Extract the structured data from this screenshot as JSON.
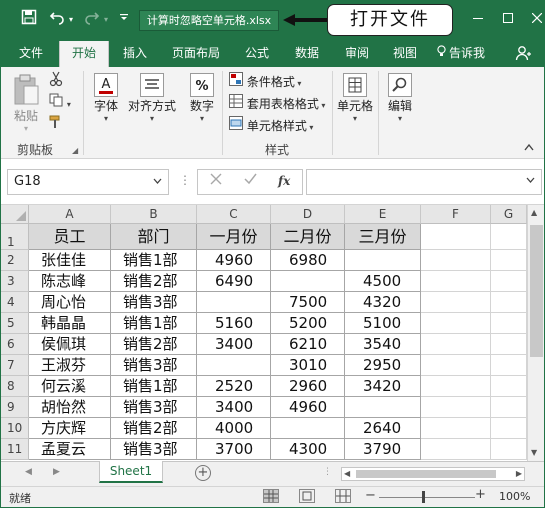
{
  "title_bar": {
    "filename": "计算时忽略空单元格.xlsx",
    "callout": "打开文件",
    "icons": [
      "save-icon",
      "undo-icon",
      "redo-icon",
      "customize-qat-icon",
      "minimize-icon",
      "restore-icon",
      "close-icon"
    ]
  },
  "ribbon_tabs": [
    "文件",
    "开始",
    "插入",
    "页面布局",
    "公式",
    "数据",
    "审阅",
    "视图"
  ],
  "active_tab": "开始",
  "tell_me": "告诉我",
  "ribbon": {
    "clipboard": {
      "paste": "粘贴",
      "group": "剪贴板"
    },
    "font": {
      "label": "字体"
    },
    "alignment": {
      "label": "对齐方式"
    },
    "number": {
      "label": "数字"
    },
    "styles": {
      "conditional": "条件格式",
      "table": "套用表格格式",
      "cell_styles": "单元格样式",
      "group": "样式"
    },
    "cells": {
      "label": "单元格"
    },
    "editing": {
      "label": "编辑"
    }
  },
  "formula_bar": {
    "name_box": "G18",
    "formula": "",
    "fx": "fx"
  },
  "columns": [
    "A",
    "B",
    "C",
    "D",
    "E",
    "F",
    "G"
  ],
  "rows": [
    "1",
    "2",
    "3",
    "4",
    "5",
    "6",
    "7",
    "8",
    "9",
    "10",
    "11"
  ],
  "table": {
    "headers": [
      "员工",
      "部门",
      "一月份",
      "二月份",
      "三月份"
    ],
    "data": [
      [
        "张佳佳",
        "销售1部",
        "4960",
        "6980",
        ""
      ],
      [
        "陈志峰",
        "销售2部",
        "6490",
        "",
        "4500"
      ],
      [
        "周心怡",
        "销售3部",
        "",
        "7500",
        "4320"
      ],
      [
        "韩晶晶",
        "销售1部",
        "5160",
        "5200",
        "5100"
      ],
      [
        "侯佩琪",
        "销售2部",
        "3400",
        "6210",
        "3540"
      ],
      [
        "王淑芬",
        "销售3部",
        "",
        "3010",
        "2950"
      ],
      [
        "何云溪",
        "销售1部",
        "2520",
        "2960",
        "3420"
      ],
      [
        "胡怡然",
        "销售3部",
        "3400",
        "4960",
        ""
      ],
      [
        "方庆辉",
        "销售2部",
        "4000",
        "",
        "2640"
      ],
      [
        "孟夏云",
        "销售3部",
        "3700",
        "4300",
        "3790"
      ]
    ]
  },
  "sheet_tab": "Sheet1",
  "status": {
    "text": "就绪",
    "zoom": "100%"
  },
  "colors": {
    "excel_green": "#217346",
    "header_fill": "#d9d9d9"
  }
}
